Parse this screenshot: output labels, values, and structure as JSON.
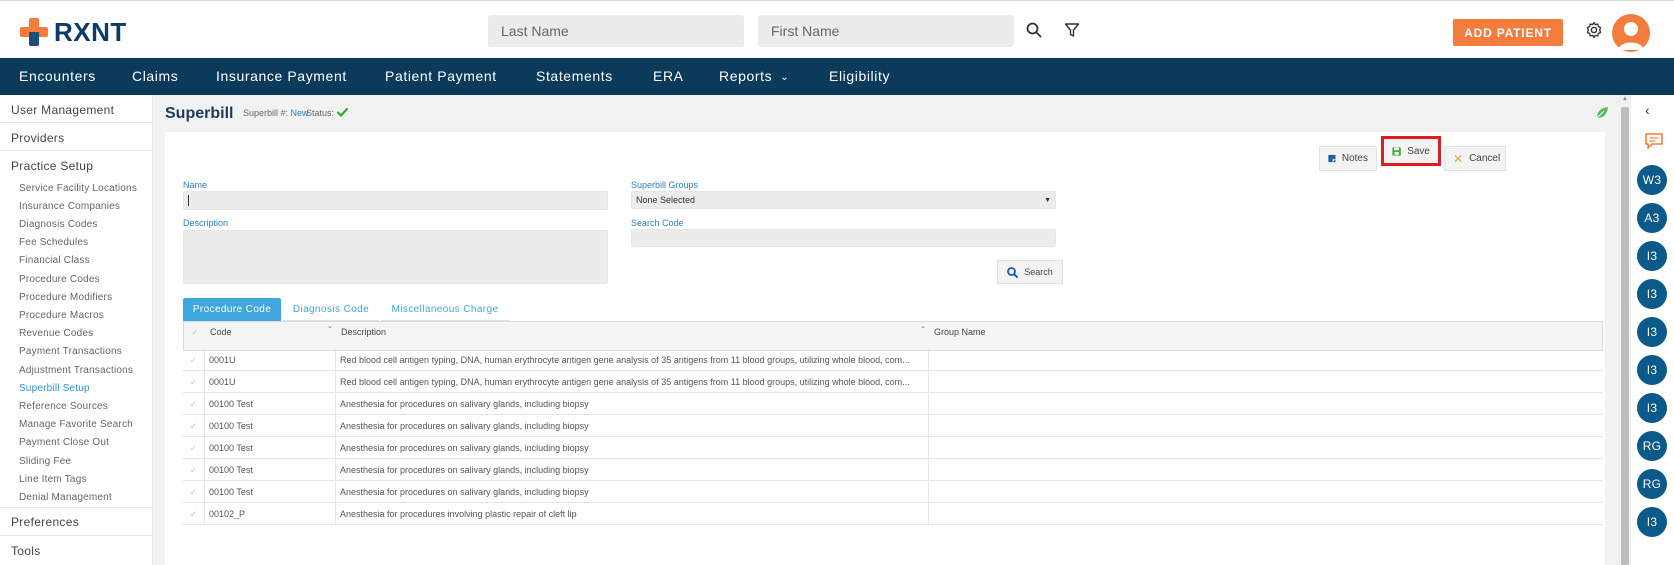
{
  "brand": {
    "name": "RXNT",
    "accent": "#f47c3c",
    "navy": "#0b3a5b"
  },
  "header": {
    "last_name_placeholder": "Last Name",
    "first_name_placeholder": "First Name",
    "search_icon": "search-icon",
    "filter_icon": "filter-icon",
    "add_patient_label": "ADD PATIENT",
    "settings_icon": "gear-icon",
    "avatar_icon": "user-avatar-icon"
  },
  "nav": {
    "items": [
      {
        "label": "Encounters"
      },
      {
        "label": "Claims"
      },
      {
        "label": "Insurance Payment"
      },
      {
        "label": "Patient Payment"
      },
      {
        "label": "Statements"
      },
      {
        "label": "ERA"
      },
      {
        "label": "Reports",
        "has_dropdown": true
      },
      {
        "label": "Eligibility"
      }
    ]
  },
  "sidebar": {
    "sections": [
      {
        "label": "User Management"
      },
      {
        "label": "Providers"
      },
      {
        "label": "Practice Setup"
      },
      {
        "label": "Preferences"
      },
      {
        "label": "Tools"
      }
    ],
    "practice_setup_items": [
      {
        "label": "Service Facility Locations"
      },
      {
        "label": "Insurance Companies"
      },
      {
        "label": "Diagnosis Codes"
      },
      {
        "label": "Fee Schedules"
      },
      {
        "label": "Financial Class"
      },
      {
        "label": "Procedure Codes"
      },
      {
        "label": "Procedure Modifiers"
      },
      {
        "label": "Procedure Macros"
      },
      {
        "label": "Revenue Codes"
      },
      {
        "label": "Payment Transactions"
      },
      {
        "label": "Adjustment Transactions"
      },
      {
        "label": "Superbill Setup",
        "active": true
      },
      {
        "label": "Reference Sources"
      },
      {
        "label": "Manage Favorite Search"
      },
      {
        "label": "Payment Close Out"
      },
      {
        "label": "Sliding Fee"
      },
      {
        "label": "Line Item Tags"
      },
      {
        "label": "Denial Management"
      }
    ]
  },
  "page": {
    "title": "Superbill",
    "superbill_label": "Superbill #:",
    "superbill_value": "New",
    "status_label": "Status:",
    "status_icon": "check-icon"
  },
  "toolbar": {
    "notes_label": "Notes",
    "save_label": "Save",
    "cancel_label": "Cancel"
  },
  "form": {
    "name_label": "Name",
    "name_value": "",
    "description_label": "Description",
    "description_value": "",
    "groups_label": "Superbill Groups",
    "groups_value": "None Selected",
    "search_code_label": "Search Code",
    "search_code_value": "",
    "search_button_label": "Search"
  },
  "tabs": [
    {
      "label": "Procedure Code",
      "active": true
    },
    {
      "label": "Diagnosis Code",
      "active": false
    },
    {
      "label": "Miscellaneous Charge",
      "active": false
    }
  ],
  "table": {
    "columns": [
      "Code",
      "Description",
      "Group Name"
    ],
    "rows": [
      {
        "code": "0001U",
        "description": "Red blood cell antigen typing, DNA, human erythrocyte antigen gene analysis of 35 antigens from 11 blood groups, utilizing whole blood, com...",
        "group": ""
      },
      {
        "code": "0001U",
        "description": "Red blood cell antigen typing, DNA, human erythrocyte antigen gene analysis of 35 antigens from 11 blood groups, utilizing whole blood, com...",
        "group": ""
      },
      {
        "code": "00100 Test",
        "description": "Anesthesia for procedures on salivary glands, including biopsy",
        "group": ""
      },
      {
        "code": "00100 Test",
        "description": "Anesthesia for procedures on salivary glands, including biopsy",
        "group": ""
      },
      {
        "code": "00100 Test",
        "description": "Anesthesia for procedures on salivary glands, including biopsy",
        "group": ""
      },
      {
        "code": "00100 Test",
        "description": "Anesthesia for procedures on salivary glands, including biopsy",
        "group": ""
      },
      {
        "code": "00100 Test",
        "description": "Anesthesia for procedures on salivary glands, including biopsy",
        "group": ""
      },
      {
        "code": "00102_P",
        "description": "Anesthesia for procedures involving plastic repair of cleft lip",
        "group": ""
      }
    ]
  },
  "dock": {
    "badges": [
      {
        "label": "W3"
      },
      {
        "label": "A3"
      },
      {
        "label": "I3"
      },
      {
        "label": "I3"
      },
      {
        "label": "I3"
      },
      {
        "label": "I3"
      },
      {
        "label": "I3"
      },
      {
        "label": "RG"
      },
      {
        "label": "RG"
      },
      {
        "label": "I3"
      }
    ]
  }
}
